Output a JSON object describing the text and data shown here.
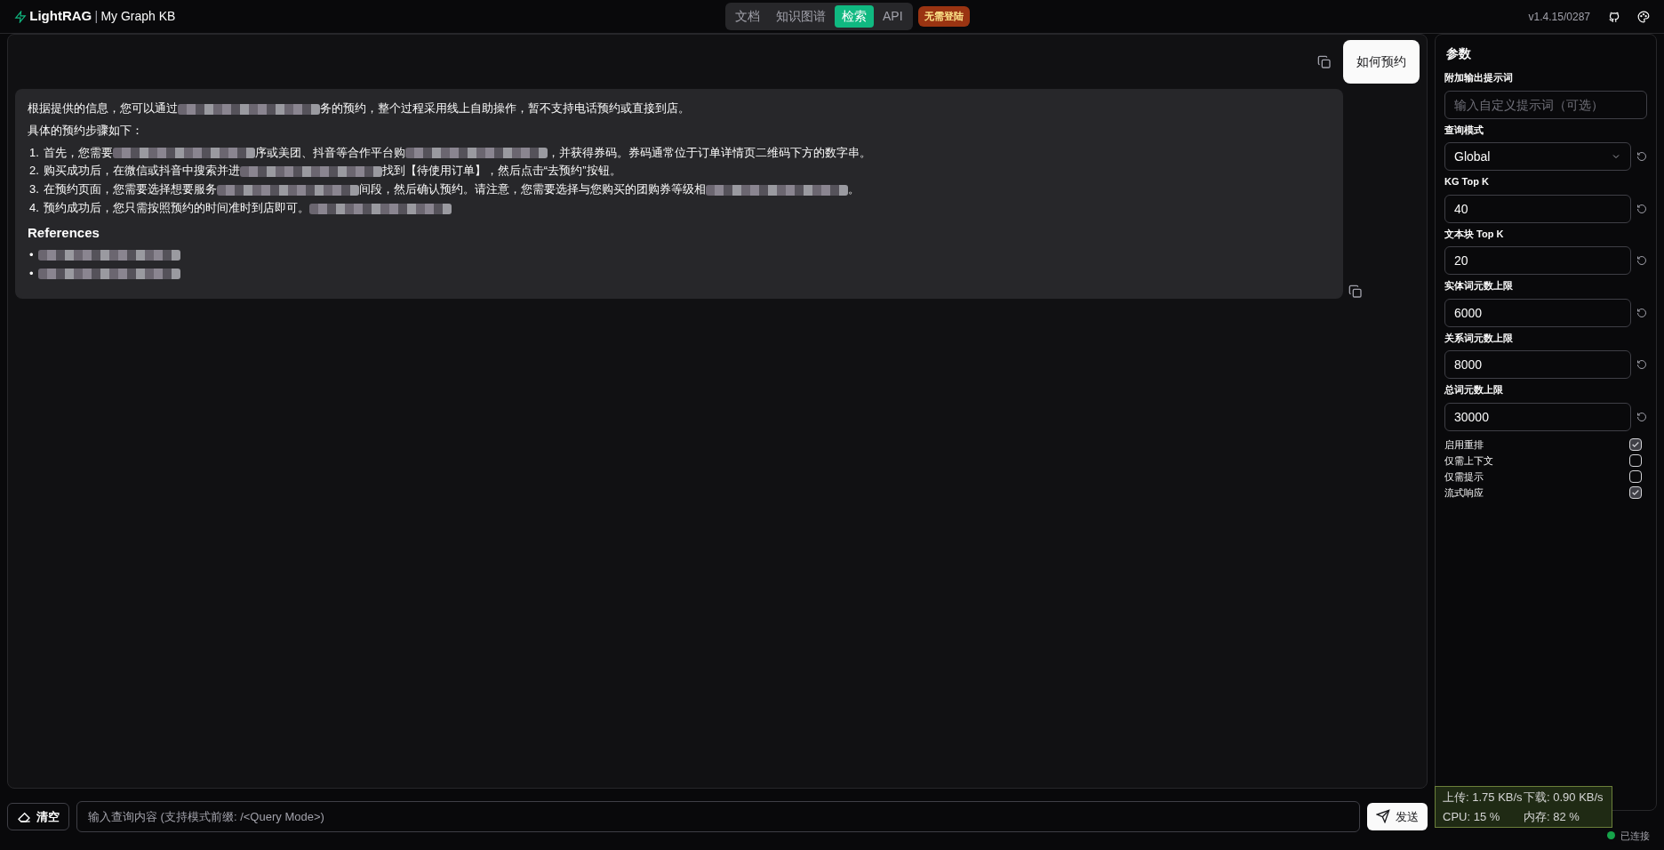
{
  "header": {
    "logo": "LightRAG",
    "separator": "|",
    "workspace": "My Graph KB",
    "tabs": [
      {
        "label": "文档",
        "selected": false
      },
      {
        "label": "知识图谱",
        "selected": false
      },
      {
        "label": "检索",
        "selected": true
      },
      {
        "label": "API",
        "selected": false
      }
    ],
    "badge": "无需登陆",
    "version": "v1.4.15/0287"
  },
  "chat": {
    "messages": [
      {
        "kind": "user",
        "text": "如何预约"
      },
      {
        "kind": "assistant",
        "blocks": [
          {
            "kind": "para",
            "segments": [
              {
                "kind": "text",
                "text": "根据提供的信息，您可以通过"
              },
              {
                "kind": "redacted"
              },
              {
                "kind": "text",
                "text": "务的预约，整个过程采用线上自助操作，暂不支持电话预约或直接到店。"
              }
            ]
          },
          {
            "kind": "para",
            "segments": [
              {
                "kind": "text",
                "text": "具体的预约步骤如下："
              }
            ]
          },
          {
            "kind": "ordered",
            "items": [
              {
                "marker": "1.",
                "segments": [
                  {
                    "kind": "text",
                    "text": "首先，您需要"
                  },
                  {
                    "kind": "redacted"
                  },
                  {
                    "kind": "text",
                    "text": "序或美团、抖音等合作平台购"
                  },
                  {
                    "kind": "redacted"
                  },
                  {
                    "kind": "text",
                    "text": "，并获得券码。券码通常位于订单详情页二维码下方的数字串。"
                  }
                ]
              },
              {
                "marker": "2.",
                "segments": [
                  {
                    "kind": "text",
                    "text": "购买成功后，在微信或抖音中搜索并进"
                  },
                  {
                    "kind": "redacted"
                  },
                  {
                    "kind": "text",
                    "text": "找到【待使用订单】，然后点击“去预约”按钮。"
                  }
                ]
              },
              {
                "marker": "3.",
                "segments": [
                  {
                    "kind": "text",
                    "text": "在预约页面，您需要选择想要服务"
                  },
                  {
                    "kind": "redacted"
                  },
                  {
                    "kind": "text",
                    "text": "间段，然后确认预约。请注意，您需要选择与您购买的团购券等级相"
                  },
                  {
                    "kind": "redacted"
                  },
                  {
                    "kind": "text",
                    "text": "。"
                  }
                ]
              },
              {
                "marker": "4.",
                "segments": [
                  {
                    "kind": "text",
                    "text": "预约成功后，您只需按照预约的时间准时到店即可。"
                  },
                  {
                    "kind": "redacted"
                  }
                ]
              }
            ]
          },
          {
            "kind": "heading",
            "segments": [
              {
                "kind": "text",
                "text": "References"
              }
            ]
          },
          {
            "kind": "bullets",
            "items": [
              {
                "marker": "•",
                "segments": [
                  {
                    "kind": "redacted"
                  }
                ]
              },
              {
                "marker": "•",
                "segments": [
                  {
                    "kind": "redacted"
                  }
                ]
              }
            ]
          }
        ]
      }
    ]
  },
  "input": {
    "clear": "清空",
    "placeholder": "输入查询内容 (支持模式前缀: /<Query Mode>)",
    "send": "发送"
  },
  "params": {
    "title": "参数",
    "prompt_label": "附加输出提示词",
    "prompt_placeholder": "输入自定义提示词（可选）",
    "fields": [
      {
        "kind": "select",
        "label": "查询模式",
        "value": "Global"
      },
      {
        "kind": "number",
        "label": "KG Top K",
        "value": "40"
      },
      {
        "kind": "number",
        "label": "文本块 Top K",
        "value": "20"
      },
      {
        "kind": "number",
        "label": "实体词元数上限",
        "value": "6000"
      },
      {
        "kind": "number",
        "label": "关系词元数上限",
        "value": "8000"
      },
      {
        "kind": "number",
        "label": "总词元数上限",
        "value": "30000"
      }
    ],
    "toggles": [
      {
        "label": "启用重排",
        "checked": true
      },
      {
        "label": "仅需上下文",
        "checked": false
      },
      {
        "label": "仅需提示",
        "checked": false
      },
      {
        "label": "流式响应",
        "checked": true
      }
    ]
  },
  "monitor": {
    "upload": "上传: 1.75 KB/s",
    "download": "下载: 0.90 KB/s",
    "cpu": "CPU: 15 %",
    "memory": "内存: 82 %"
  },
  "status": {
    "text": "已连接",
    "color": "#16a34a"
  }
}
